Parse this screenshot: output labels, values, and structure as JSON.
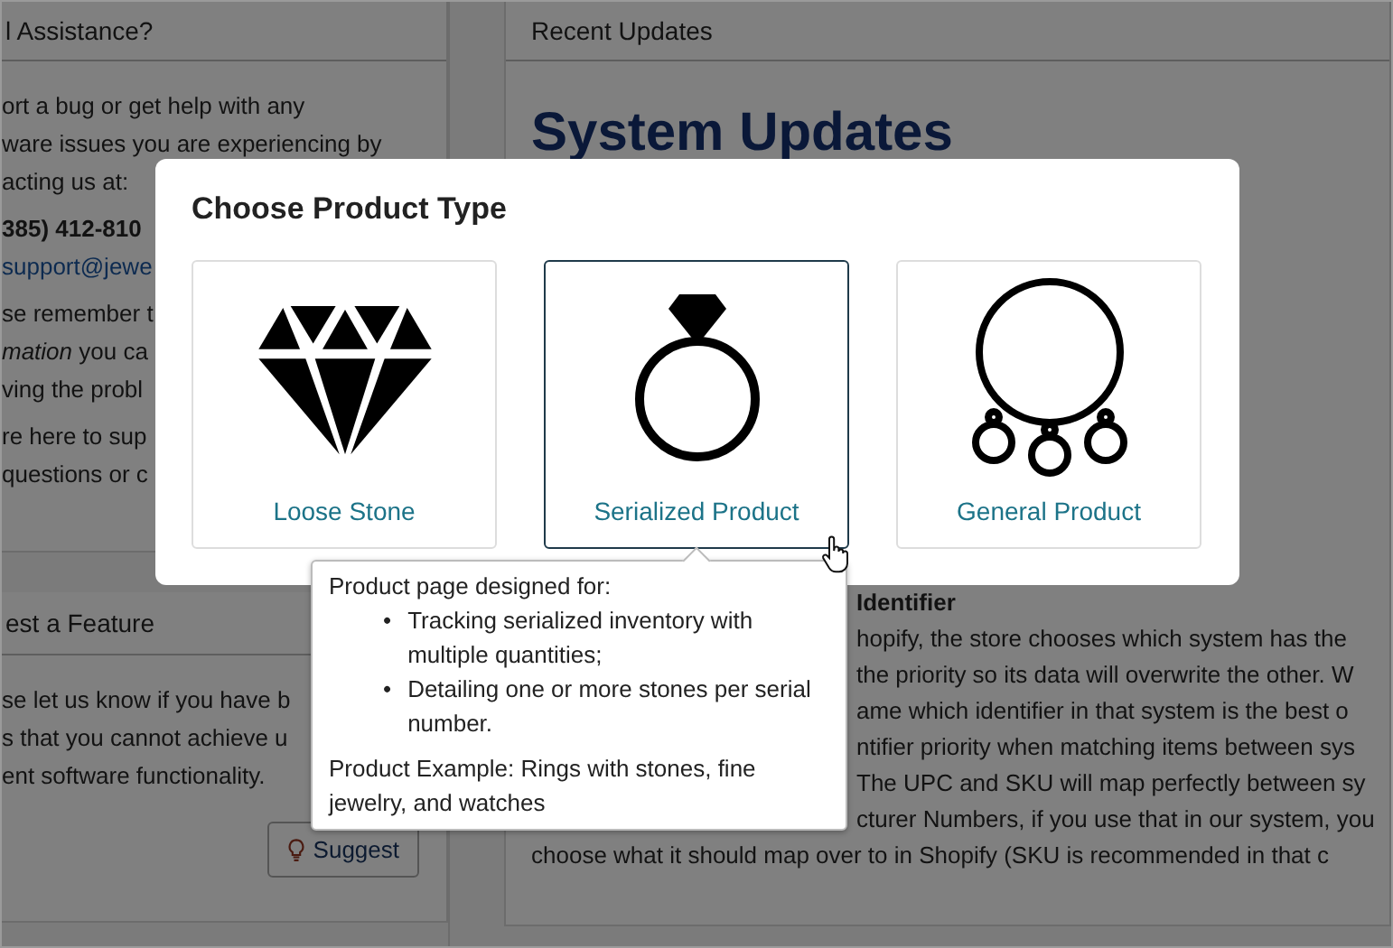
{
  "assistance_card": {
    "title": "l Assistance?",
    "paragraphs": [
      {
        "kind": "text",
        "lines": [
          "ort a bug or get help with any",
          "ware issues you are experiencing by",
          "acting us at:"
        ]
      },
      {
        "kind": "phone",
        "lines": [
          "385) 412-810"
        ]
      },
      {
        "kind": "link",
        "lines": [
          "support@jewe"
        ]
      },
      {
        "kind": "text",
        "lines": [
          "se remember t",
          "*mation* you ca",
          "ving the probl"
        ]
      },
      {
        "kind": "text",
        "lines": [
          "re here to sup",
          "questions or c"
        ]
      }
    ]
  },
  "feature_card": {
    "title": "est a Feature",
    "lines": [
      "se let us know if you have b",
      "s that you cannot achieve u",
      "ent software functionality."
    ],
    "button": "Suggest"
  },
  "updates_panel": {
    "title": "Recent Updates",
    "heading": "System Updates",
    "section_heading": "Identifier",
    "lines": [
      "hopify, the store chooses which system has the",
      "the priority so its data will overwrite the other. W",
      "ame which identifier in that system is the best o",
      "ntifier priority when matching items between sys",
      "The UPC and SKU will map perfectly between sy",
      "cturer Numbers, if you use that in our system, you",
      "choose what it should map over to in Shopify (SKU is recommended in that c"
    ]
  },
  "dialog": {
    "title": "Choose Product Type",
    "options": [
      {
        "label": "Loose Stone",
        "kind": "diamond",
        "selected": false
      },
      {
        "label": "Serialized Product",
        "kind": "ring",
        "selected": true
      },
      {
        "label": "General Product",
        "kind": "pendant",
        "selected": false
      }
    ]
  },
  "tooltip": {
    "marker": "•",
    "intro": "Product page designed for:",
    "bullets": [
      "Tracking serialized inventory with multiple quantities;",
      "Detailing one or more stones per serial number."
    ],
    "example": "Product Example: Rings with stones, fine jewelry, and watches"
  }
}
